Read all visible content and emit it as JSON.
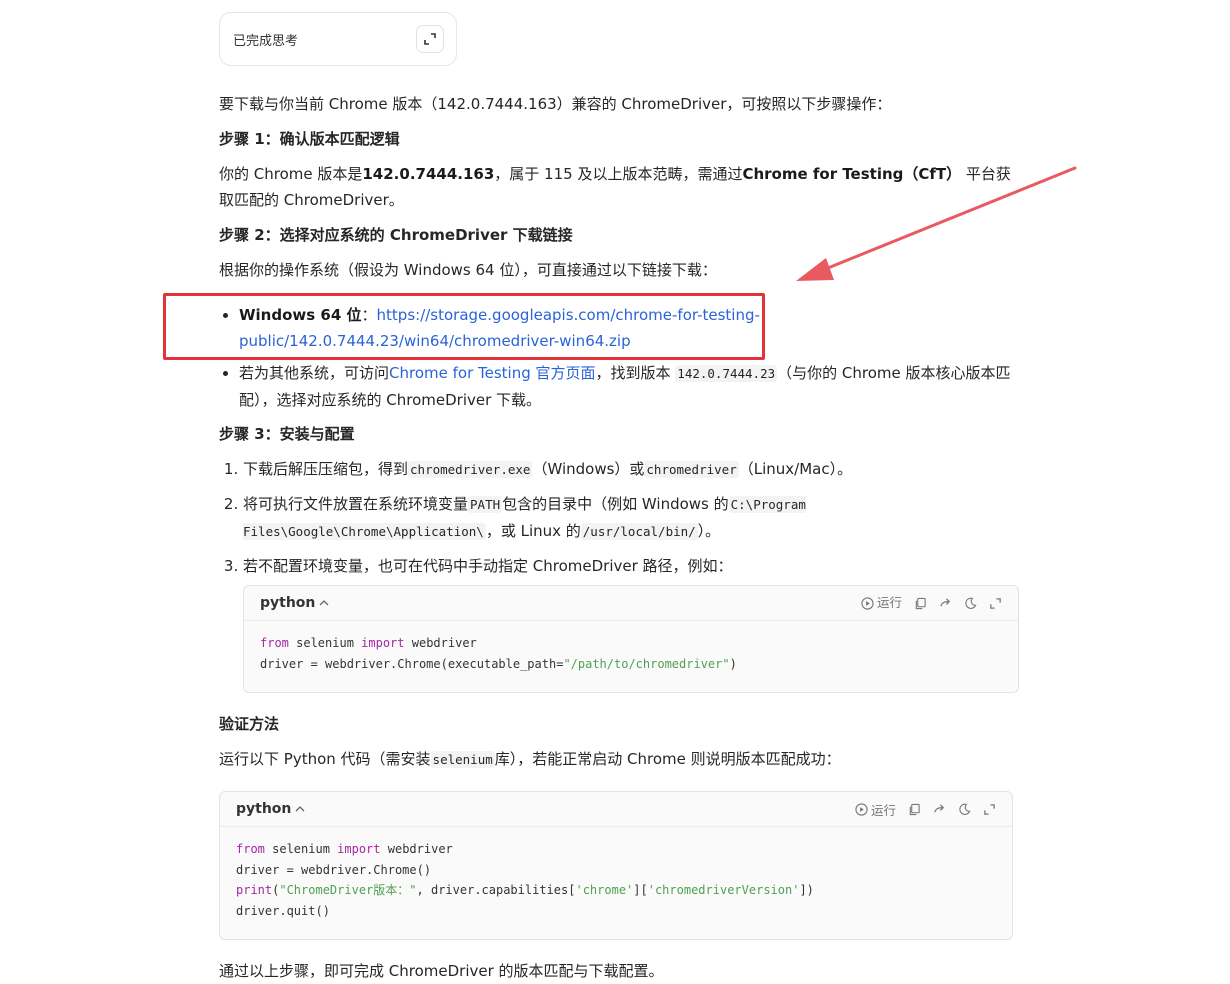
{
  "thinking": {
    "label": "已完成思考",
    "expand_icon": "expand-icon"
  },
  "intro": "要下载与你当前 Chrome 版本（142.0.7444.163）兼容的 ChromeDriver，可按照以下步骤操作：",
  "step1": {
    "heading": "步骤 1：确认版本匹配逻辑",
    "p_a": "你的 Chrome 版本是",
    "p_b": "142.0.7444.163",
    "p_c": "，属于 115 及以上版本范畴，需通过",
    "p_d": "Chrome for Testing（CfT）",
    "p_e": " 平台获取匹配的 ChromeDriver。"
  },
  "step2": {
    "heading": "步骤 2：选择对应系统的 ChromeDriver 下载链接",
    "p": "根据你的操作系统（假设为 Windows 64 位），可直接通过以下链接下载：",
    "item1_label": "Windows 64 位",
    "item1_sep": "：",
    "item1_link": "https://storage.googleapis.com/chrome-for-testing-public/142.0.7444.23/win64/chromedriver-win64.zip",
    "item2_a": "若为其他系统，可访问",
    "item2_link": "Chrome for Testing 官方页面",
    "item2_b": "，找到版本 ",
    "item2_code": "142.0.7444.23",
    "item2_c": "（与你的 Chrome 版本核心版本匹配），选择对应系统的 ChromeDriver 下载。"
  },
  "step3": {
    "heading": "步骤 3：安装与配置",
    "li1_a": "下载后解压压缩包，得到",
    "li1_code1": "chromedriver.exe",
    "li1_b": "（Windows）或",
    "li1_code2": "chromedriver",
    "li1_c": "（Linux/Mac）。",
    "li2_a": "将可执行文件放置在系统环境变量",
    "li2_code1": "PATH",
    "li2_b": "包含的目录中（例如 Windows 的",
    "li2_code2": "C:\\Program Files\\Google\\Chrome\\Application\\",
    "li2_c": "，或 Linux 的",
    "li2_code3": "/usr/local/bin/",
    "li2_d": "）。",
    "li3": "若不配置环境变量，也可在代码中手动指定 ChromeDriver 路径，例如："
  },
  "code1": {
    "lang": "python",
    "run_label": "运行",
    "lines": [
      [
        {
          "t": "from",
          "c": "kw"
        },
        {
          "t": " selenium "
        },
        {
          "t": "import",
          "c": "kw"
        },
        {
          "t": " webdriver"
        }
      ],
      [
        {
          "t": "driver = webdriver.Chrome(executable_path="
        },
        {
          "t": "\"/path/to/chromedriver\"",
          "c": "str"
        },
        {
          "t": ")"
        }
      ]
    ]
  },
  "verify": {
    "heading": "验证方法",
    "p_a": "运行以下 Python 代码（需安装",
    "p_code": "selenium",
    "p_b": "库），若能正常启动 Chrome 则说明版本匹配成功："
  },
  "code2": {
    "lang": "python",
    "run_label": "运行",
    "lines": [
      [
        {
          "t": "from",
          "c": "kw"
        },
        {
          "t": " selenium "
        },
        {
          "t": "import",
          "c": "kw"
        },
        {
          "t": " webdriver"
        }
      ],
      [
        {
          "t": "driver = webdriver.Chrome()"
        }
      ],
      [
        {
          "t": "print",
          "c": "fn"
        },
        {
          "t": "("
        },
        {
          "t": "\"ChromeDriver版本：\"",
          "c": "str"
        },
        {
          "t": ", driver.capabilities["
        },
        {
          "t": "'chrome'",
          "c": "str"
        },
        {
          "t": "]["
        },
        {
          "t": "'chromedriverVersion'",
          "c": "str"
        },
        {
          "t": "])"
        }
      ],
      [
        {
          "t": "driver.quit()"
        }
      ]
    ]
  },
  "outro": "通过以上步骤，即可完成 ChromeDriver 的版本匹配与下载配置。",
  "colors": {
    "link": "#2a63d8",
    "highlight": "#e0333a",
    "keyword": "#a626a4",
    "string": "#50a14f"
  }
}
